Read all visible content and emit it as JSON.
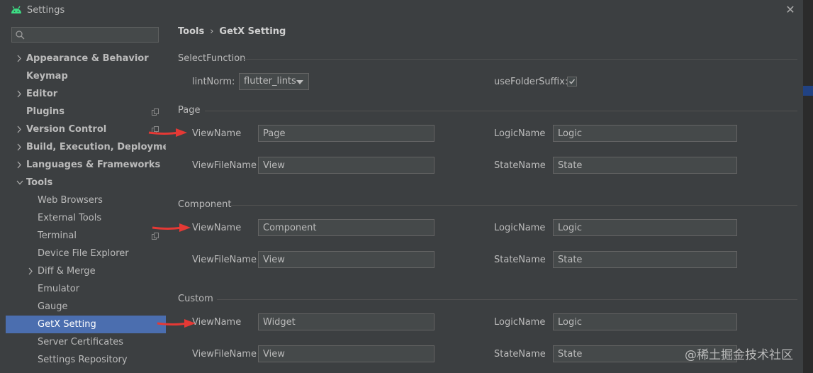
{
  "window": {
    "title": "Settings",
    "close_icon": "close-icon"
  },
  "search": {
    "placeholder": "",
    "icon": "search-icon"
  },
  "sidebar": {
    "items": [
      {
        "label": "Appearance & Behavior",
        "expandable": true,
        "bold": true
      },
      {
        "label": "Keymap",
        "expandable": false,
        "bold": true
      },
      {
        "label": "Editor",
        "expandable": true,
        "bold": true
      },
      {
        "label": "Plugins",
        "expandable": false,
        "bold": true,
        "copy_icon": true
      },
      {
        "label": "Version Control",
        "expandable": true,
        "bold": true,
        "copy_icon": true
      },
      {
        "label": "Build, Execution, Deployment",
        "expandable": true,
        "bold": true
      },
      {
        "label": "Languages & Frameworks",
        "expandable": true,
        "bold": true
      },
      {
        "label": "Tools",
        "expandable": true,
        "expanded": true,
        "bold": true
      },
      {
        "label": "Web Browsers",
        "child": true
      },
      {
        "label": "External Tools",
        "child": true
      },
      {
        "label": "Terminal",
        "child": true,
        "copy_icon": true
      },
      {
        "label": "Device File Explorer",
        "child": true
      },
      {
        "label": "Diff & Merge",
        "child": true,
        "expandable": true
      },
      {
        "label": "Emulator",
        "child": true
      },
      {
        "label": "Gauge",
        "child": true
      },
      {
        "label": "GetX Setting",
        "child": true,
        "selected": true
      },
      {
        "label": "Server Certificates",
        "child": true
      },
      {
        "label": "Settings Repository",
        "child": true
      }
    ]
  },
  "breadcrumb": {
    "parent": "Tools",
    "separator": "›",
    "current": "GetX Setting"
  },
  "select_function": {
    "title": "SelectFunction",
    "lint_label": "lintNorm:",
    "lint_value": "flutter_lints",
    "folder_suffix_label": "useFolderSuffix:",
    "folder_suffix_checked": true
  },
  "page": {
    "title": "Page",
    "view_name_label": "ViewName",
    "view_name": "Page",
    "logic_name_label": "LogicName",
    "logic_name": "Logic",
    "view_file_name_label": "ViewFileName",
    "view_file_name": "View",
    "state_name_label": "StateName",
    "state_name": "State"
  },
  "component": {
    "title": "Component",
    "view_name_label": "ViewName",
    "view_name": "Component",
    "logic_name_label": "LogicName",
    "logic_name": "Logic",
    "view_file_name_label": "ViewFileName",
    "view_file_name": "View",
    "state_name_label": "StateName",
    "state_name": "State"
  },
  "custom": {
    "title": "Custom",
    "view_name_label": "ViewName",
    "view_name": "Widget",
    "logic_name_label": "LogicName",
    "logic_name": "Logic",
    "view_file_name_label": "ViewFileName",
    "view_file_name": "View",
    "state_name_label": "StateName",
    "state_name": "State"
  },
  "watermark": "@稀土掘金技术社区",
  "colors": {
    "background": "#3c3f41",
    "selection": "#4b6eaf",
    "field_bg": "#45494a",
    "annotation_arrow": "#e53935"
  }
}
